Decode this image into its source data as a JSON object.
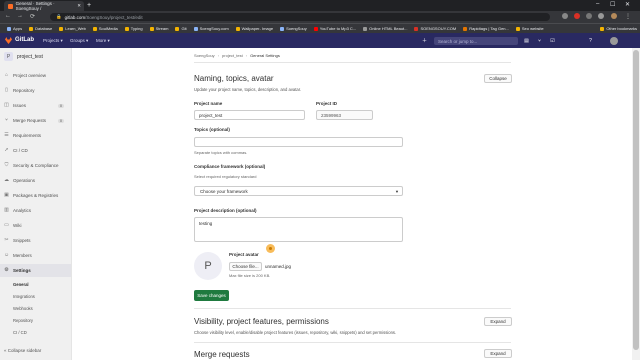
{
  "browser": {
    "tab_title": "General · Settings · SoengSouy /",
    "new_tab": "+",
    "url_host": "gitlab.com",
    "url_path": "/SoengSouy/project_test/edit",
    "bookmarks": [
      "Apps",
      "Database",
      "Learn_Web",
      "SoulMedia",
      "Typing",
      "Stream",
      "Git",
      "SoengSouy.com",
      "Wallpaper- Image",
      "SoengSouy",
      "YouTube to Mp3 C...",
      "Online HTML Beaut...",
      "SOENGSOUY.COM",
      "Rapidtags | Tag Gen...",
      "Seo website"
    ],
    "other_bookmarks": "Other bookmarks"
  },
  "gitlab_header": {
    "brand": "GitLab",
    "menu": [
      "Projects ▾",
      "Groups ▾",
      "More ▾"
    ],
    "search_placeholder": "Search or jump to..."
  },
  "sidebar": {
    "project_initial": "P",
    "project_name": "project_test",
    "items": [
      {
        "label": "Project overview",
        "icon": "home-icon"
      },
      {
        "label": "Repository",
        "icon": "doc-icon"
      },
      {
        "label": "Issues",
        "icon": "issues-icon",
        "count": "0"
      },
      {
        "label": "Merge Requests",
        "icon": "merge-icon",
        "count": "0"
      },
      {
        "label": "Requirements",
        "icon": "list-icon"
      },
      {
        "label": "CI / CD",
        "icon": "rocket-icon"
      },
      {
        "label": "Security & Compliance",
        "icon": "shield-icon"
      },
      {
        "label": "Operations",
        "icon": "cloud-icon"
      },
      {
        "label": "Packages & Registries",
        "icon": "package-icon"
      },
      {
        "label": "Analytics",
        "icon": "chart-icon"
      },
      {
        "label": "Wiki",
        "icon": "book-icon"
      },
      {
        "label": "Snippets",
        "icon": "snippet-icon"
      },
      {
        "label": "Members",
        "icon": "users-icon"
      },
      {
        "label": "Settings",
        "icon": "gear-icon"
      }
    ],
    "sub_items": [
      "General",
      "Integrations",
      "Webhooks",
      "Repository",
      "CI / CD"
    ],
    "collapse_label": "« Collapse sidebar"
  },
  "breadcrumb": [
    "SoengSouy",
    "project_test",
    "General Settings"
  ],
  "naming_section": {
    "title": "Naming, topics, avatar",
    "description": "Update your project name, topics, description, and avatar.",
    "collapse_button": "Collapse",
    "project_name_label": "Project name",
    "project_name_value": "project_test",
    "project_id_label": "Project ID",
    "project_id_value": "23599963",
    "topics_label": "Topics (optional)",
    "topics_help": "Separate topics with commas.",
    "compliance_label": "Compliance framework (optional)",
    "compliance_help": "Select required regulatory standard",
    "compliance_select": "Choose your framework",
    "description_label": "Project description (optional)",
    "description_value": "testing",
    "avatar_initial": "P",
    "avatar_label": "Project avatar",
    "choose_file": "Choose file...",
    "file_name": "unnamed.jpg",
    "max_size": "Max file size is 200 KB.",
    "save_button": "Save changes"
  },
  "visibility_section": {
    "title": "Visibility, project features, permissions",
    "description": "Choose visibility level, enable/disable project features (issues, repository, wiki, snippets) and set permissions.",
    "expand_button": "Expand"
  },
  "merge_section": {
    "title": "Merge requests",
    "expand_button": "Expand"
  }
}
